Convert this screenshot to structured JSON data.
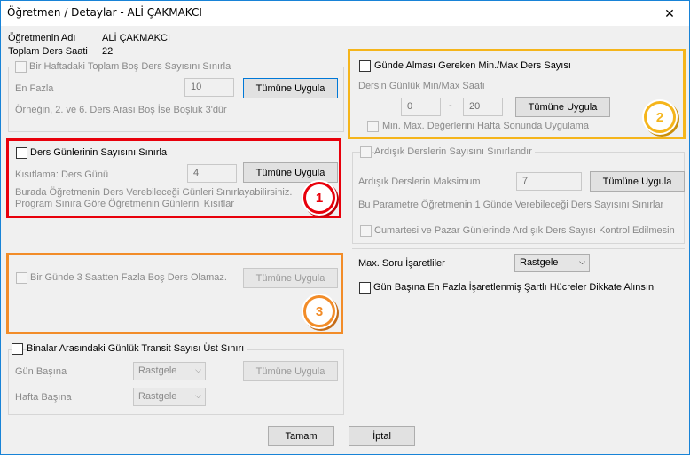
{
  "window": {
    "title": "Öğretmen / Detaylar - ALİ ÇAKMAKCI",
    "close_glyph": "✕"
  },
  "teacher": {
    "name_label": "Öğretmenin Adı",
    "name_value": "ALİ ÇAKMAKCI",
    "hours_label": "Toplam Ders Saati",
    "hours_value": "22"
  },
  "weekly_gap": {
    "checkbox_label": "Bir Haftadaki Toplam Boş Ders Sayısını Sınırla",
    "max_label": "En Fazla",
    "max_value": "10",
    "apply_label": "Tümüne Uygula",
    "example": "Örneğin, 2. ve 6. Ders Arası Boş İse Boşluk 3'dür"
  },
  "day_count": {
    "checkbox_label": "Ders Günlerinin Sayısını Sınırla",
    "limit_label": "Kısıtlama: Ders Günü",
    "limit_value": "4",
    "apply_label": "Tümüne Uygula",
    "desc1": "Burada Öğretmenin Ders Verebileceği Günleri Sınırlayabilirsiniz.",
    "desc2": "Program Sınıra Göre Öğretmenin Günlerini Kısıtlar",
    "badge": "1"
  },
  "daily_gap": {
    "checkbox_label": "Bir Günde 3 Saatten Fazla Boş Ders Olamaz.",
    "apply_label": "Tümüne Uygula",
    "badge": "3"
  },
  "transit": {
    "checkbox_label": "Binalar Arasındaki Günlük Transit Sayısı Üst Sınırı",
    "day_label": "Gün Başına",
    "day_value": "Rastgele",
    "week_label": "Hafta Başına",
    "week_value": "Rastgele",
    "apply_label": "Tümüne Uygula"
  },
  "daily_minmax": {
    "checkbox_label": "Günde Alması Gereken Min./Max Ders Sayısı",
    "sub_label": "Dersin Günlük Min/Max Saati",
    "min_value": "0",
    "dash": "-",
    "max_value": "20",
    "apply_label": "Tümüne Uygula",
    "weekend_label": "Min. Max. Değerlerini Hafta Sonunda Uygulama",
    "badge": "2"
  },
  "consecutive": {
    "checkbox_label": "Ardışık Derslerin Sayısını Sınırlandır",
    "max_label": "Ardışık Derslerin Maksimum",
    "max_value": "7",
    "apply_label": "Tümüne Uygula",
    "desc": "Bu Parametre Öğretmenin 1 Günde Verebileceği Ders Sayısını Sınırlar",
    "weekend_label": "Cumartesi ve Pazar Günlerinde Ardışık Ders Sayısı Kontrol Edilmesin"
  },
  "marks": {
    "label": "Max. Soru İşaretliler",
    "value": "Rastgele",
    "checkbox_label": "Gün Başına En Fazla İşaretlenmiş Şartlı Hücreler Dikkate Alınsın"
  },
  "footer": {
    "ok_label": "Tamam",
    "cancel_label": "İptal"
  },
  "colors": {
    "red": "#e8000b",
    "yellow": "#f5b51b",
    "orange": "#f28c28",
    "focus_blue": "#0078d7"
  }
}
